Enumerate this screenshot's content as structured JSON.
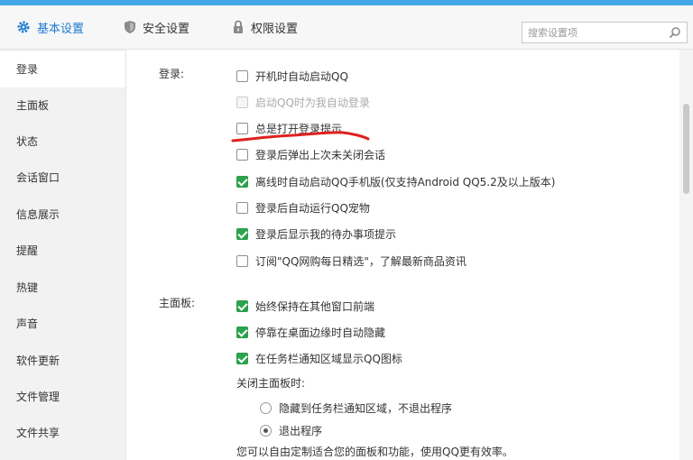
{
  "tabs": [
    {
      "label": "基本设置",
      "icon": "gear-icon",
      "active": true
    },
    {
      "label": "安全设置",
      "icon": "shield-icon",
      "active": false
    },
    {
      "label": "权限设置",
      "icon": "lock-icon",
      "active": false
    }
  ],
  "search": {
    "placeholder": "搜索设置项"
  },
  "sidebar": {
    "items": [
      {
        "label": "登录"
      },
      {
        "label": "主面板"
      },
      {
        "label": "状态"
      },
      {
        "label": "会话窗口"
      },
      {
        "label": "信息展示"
      },
      {
        "label": "提醒"
      },
      {
        "label": "热键"
      },
      {
        "label": "声音"
      },
      {
        "label": "软件更新"
      },
      {
        "label": "文件管理"
      },
      {
        "label": "文件共享"
      }
    ]
  },
  "login": {
    "label": "登录:",
    "options": [
      {
        "label": "开机时自动启动QQ",
        "checked": false,
        "disabled": false
      },
      {
        "label": "启动QQ时为我自动登录",
        "checked": false,
        "disabled": true
      },
      {
        "label": "总是打开登录提示",
        "checked": false,
        "disabled": false
      },
      {
        "label": "登录后弹出上次未关闭会话",
        "checked": false,
        "disabled": false
      },
      {
        "label": "离线时自动启动QQ手机版(仅支持Android QQ5.2及以上版本)",
        "checked": true,
        "disabled": false
      },
      {
        "label": "登录后自动运行QQ宠物",
        "checked": false,
        "disabled": false
      },
      {
        "label": "登录后显示我的待办事项提示",
        "checked": true,
        "disabled": false
      },
      {
        "label": "订阅\"QQ网购每日精选\"，了解最新商品资讯",
        "checked": false,
        "disabled": false
      }
    ]
  },
  "main_panel": {
    "label": "主面板:",
    "options": [
      {
        "label": "始终保持在其他窗口前端",
        "checked": true
      },
      {
        "label": "停靠在桌面边缘时自动隐藏",
        "checked": true
      },
      {
        "label": "在任务栏通知区域显示QQ图标",
        "checked": true
      }
    ],
    "close_label": "关闭主面板时:",
    "close_options": [
      {
        "label": "隐藏到任务栏通知区域，不退出程序",
        "checked": false
      },
      {
        "label": "退出程序",
        "checked": true
      }
    ],
    "footer_text": "您可以自由定制适合您的面板和功能，使用QQ更有效率。"
  },
  "colors": {
    "accent": "#1e7ad2",
    "title_bar": "#41a7e6",
    "checkbox_checked": "#2ca44f",
    "annotation": "#e02020"
  }
}
